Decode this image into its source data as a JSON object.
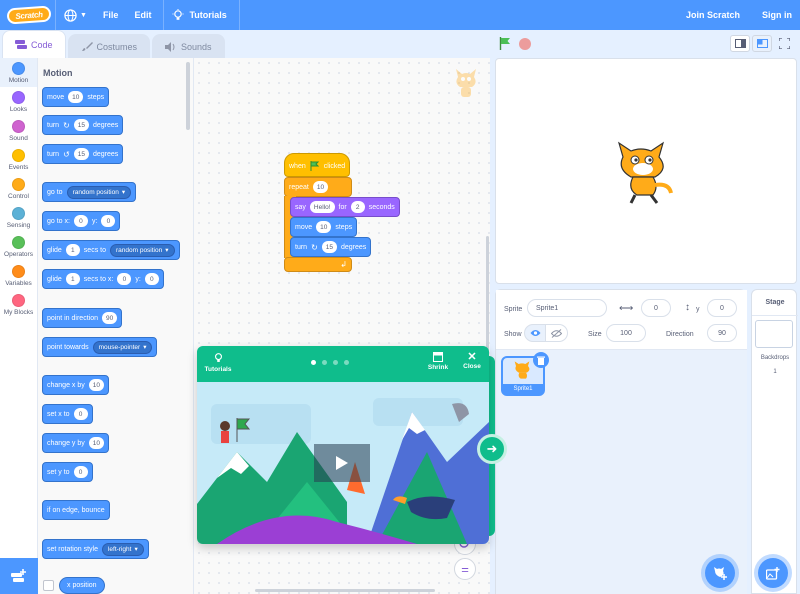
{
  "menubar": {
    "logo_text": "Scratch",
    "file": "File",
    "edit": "Edit",
    "tutorials": "Tutorials",
    "join": "Join Scratch",
    "signin": "Sign in"
  },
  "tabs": {
    "code": "Code",
    "costumes": "Costumes",
    "sounds": "Sounds"
  },
  "categories": [
    {
      "label": "Motion",
      "color": "#4c97ff"
    },
    {
      "label": "Looks",
      "color": "#9966ff"
    },
    {
      "label": "Sound",
      "color": "#cf63cf"
    },
    {
      "label": "Events",
      "color": "#ffbf00"
    },
    {
      "label": "Control",
      "color": "#ffab19"
    },
    {
      "label": "Sensing",
      "color": "#5cb1d6"
    },
    {
      "label": "Operators",
      "color": "#59c059"
    },
    {
      "label": "Variables",
      "color": "#ff8c1a"
    },
    {
      "label": "My Blocks",
      "color": "#ff6680"
    }
  ],
  "palette": {
    "title": "Motion",
    "move": {
      "a": "move",
      "v": "10",
      "b": "steps"
    },
    "turn_r": {
      "a": "turn",
      "v": "15",
      "b": "degrees"
    },
    "turn_l": {
      "a": "turn",
      "v": "15",
      "b": "degrees"
    },
    "goto": {
      "a": "go to",
      "d": "random position"
    },
    "gotoxy": {
      "a": "go to x:",
      "x": "0",
      "b": "y:",
      "y": "0"
    },
    "glide1": {
      "a": "glide",
      "v": "1",
      "b": "secs to",
      "d": "random position"
    },
    "glide2": {
      "a": "glide",
      "v": "1",
      "b": "secs to x:",
      "x": "0",
      "c": "y:",
      "y": "0"
    },
    "point_dir": {
      "a": "point in direction",
      "v": "90"
    },
    "point_tow": {
      "a": "point towards",
      "d": "mouse-pointer"
    },
    "chx": {
      "a": "change x by",
      "v": "10"
    },
    "setx": {
      "a": "set x to",
      "v": "0"
    },
    "chy": {
      "a": "change y by",
      "v": "10"
    },
    "sety": {
      "a": "set y to",
      "v": "0"
    },
    "bounce": {
      "a": "if on edge, bounce"
    },
    "rotstyle": {
      "a": "set rotation style",
      "d": "left-right"
    },
    "xpos": {
      "a": "x position"
    }
  },
  "script": {
    "hat": {
      "a": "when",
      "b": "clicked"
    },
    "repeat": {
      "a": "repeat",
      "v": "10"
    },
    "say": {
      "a": "say",
      "msg": "Hello!",
      "b": "for",
      "v": "2",
      "c": "seconds"
    },
    "move": {
      "a": "move",
      "v": "10",
      "b": "steps"
    },
    "turn": {
      "a": "turn",
      "v": "15",
      "b": "degrees"
    }
  },
  "sprite_info": {
    "sprite_label": "Sprite",
    "sprite_name": "Sprite1",
    "x_val": "0",
    "y_label": "y",
    "y_val": "0",
    "show_label": "Show",
    "size_label": "Size",
    "size_val": "100",
    "direction_label": "Direction",
    "direction_val": "90"
  },
  "sprite_list": [
    {
      "name": "Sprite1"
    }
  ],
  "stage_pane": {
    "title": "Stage",
    "backdrops_label": "Backdrops",
    "backdrops_count": "1"
  },
  "tutorial": {
    "tutorials_label": "Tutorials",
    "shrink": "Shrink",
    "close": "Close",
    "steps": 4,
    "current_step": 1
  },
  "colors": {
    "menubar": "#4c97ff",
    "motion": "#4c97ff",
    "control": "#ffab19",
    "events": "#ffbf00",
    "looks": "#9966ff",
    "tutorial": "#0fbd8c"
  }
}
